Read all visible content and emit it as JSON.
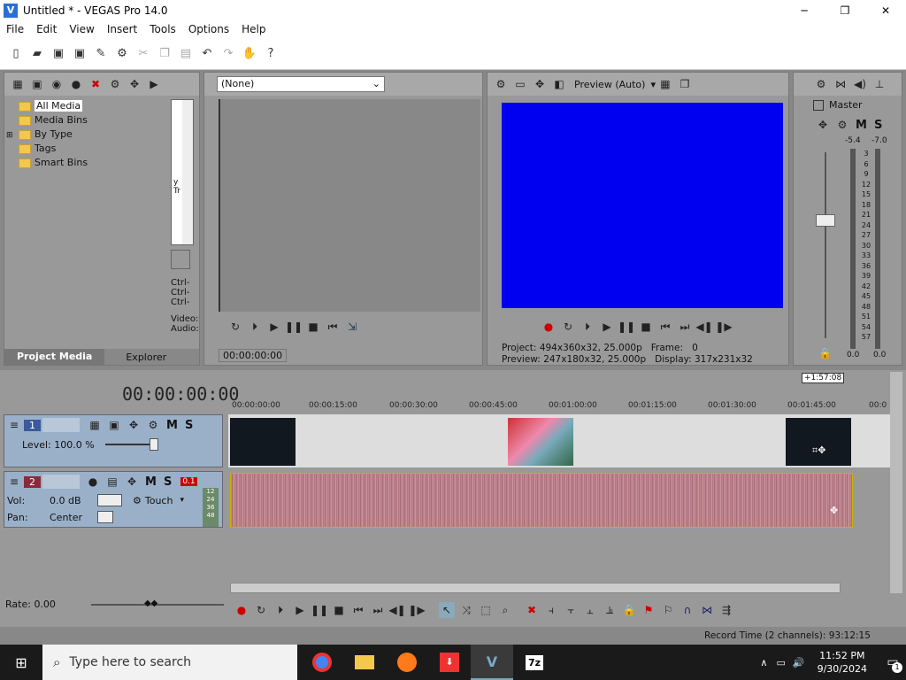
{
  "window": {
    "title": "Untitled * - VEGAS Pro 14.0",
    "min": "─",
    "max": "❐",
    "close": "✕"
  },
  "menu": [
    "File",
    "Edit",
    "View",
    "Insert",
    "Tools",
    "Options",
    "Help"
  ],
  "project_media": {
    "tree": [
      "All Media",
      "Media Bins",
      "By Type",
      "Tags",
      "Smart Bins"
    ],
    "side_text": [
      "y",
      "Tr"
    ],
    "ctrl_labels": [
      "Ctrl-",
      "Ctrl-",
      "Ctrl-"
    ],
    "va_labels": [
      "Video:",
      "Audio:"
    ],
    "tabs": [
      "Project Media",
      "Explorer"
    ]
  },
  "trimmer": {
    "dropdown": "(None)",
    "timecode": "00:00:00:00"
  },
  "preview": {
    "mode": "Preview (Auto)",
    "screen_color": "#0000f0",
    "project_label": "Project:",
    "project_value": "494x360x32, 25.000p",
    "frame_label": "Frame:",
    "frame_value": "0",
    "preview_label": "Preview:",
    "preview_value": "247x180x32, 25.000p",
    "display_label": "Display:",
    "display_value": "317x231x32"
  },
  "master": {
    "label": "Master",
    "m": "M",
    "s": "S",
    "peak_l": "-5.4",
    "peak_r": "-7.0",
    "scale": [
      "3",
      "6",
      "9",
      "12",
      "15",
      "18",
      "21",
      "24",
      "27",
      "30",
      "33",
      "36",
      "39",
      "42",
      "45",
      "48",
      "51",
      "54",
      "57"
    ],
    "bottom_l": "0.0",
    "bottom_r": "0.0"
  },
  "timeline": {
    "timecode": "00:00:00:00",
    "end_marker": "+1:57:08",
    "ruler": [
      "00:00:00:00",
      "00:00:15:00",
      "00:00:30:00",
      "00:00:45:00",
      "00:01:00:00",
      "00:01:15:00",
      "00:01:30:00",
      "00:01:45:00",
      "00:0"
    ]
  },
  "tracks": {
    "video": {
      "num": "1",
      "level_label": "Level:",
      "level_value": "100.0 %",
      "m": "M",
      "s": "S"
    },
    "audio": {
      "num": "2",
      "vol_label": "Vol:",
      "vol_value": "0.0 dB",
      "pan_label": "Pan:",
      "pan_value": "Center",
      "mode": "Touch",
      "m": "M",
      "s": "S",
      "meter_peak": "0.1",
      "meter_scale": [
        "12",
        "24",
        "36",
        "48"
      ]
    }
  },
  "rate": {
    "label": "Rate:",
    "value": "0.00"
  },
  "status": {
    "record_time": "Record Time (2 channels): 93:12:15"
  },
  "taskbar": {
    "search_placeholder": "Type here to search",
    "time": "11:52 PM",
    "date": "9/30/2024",
    "notif": "1",
    "app_7z": "7z"
  }
}
